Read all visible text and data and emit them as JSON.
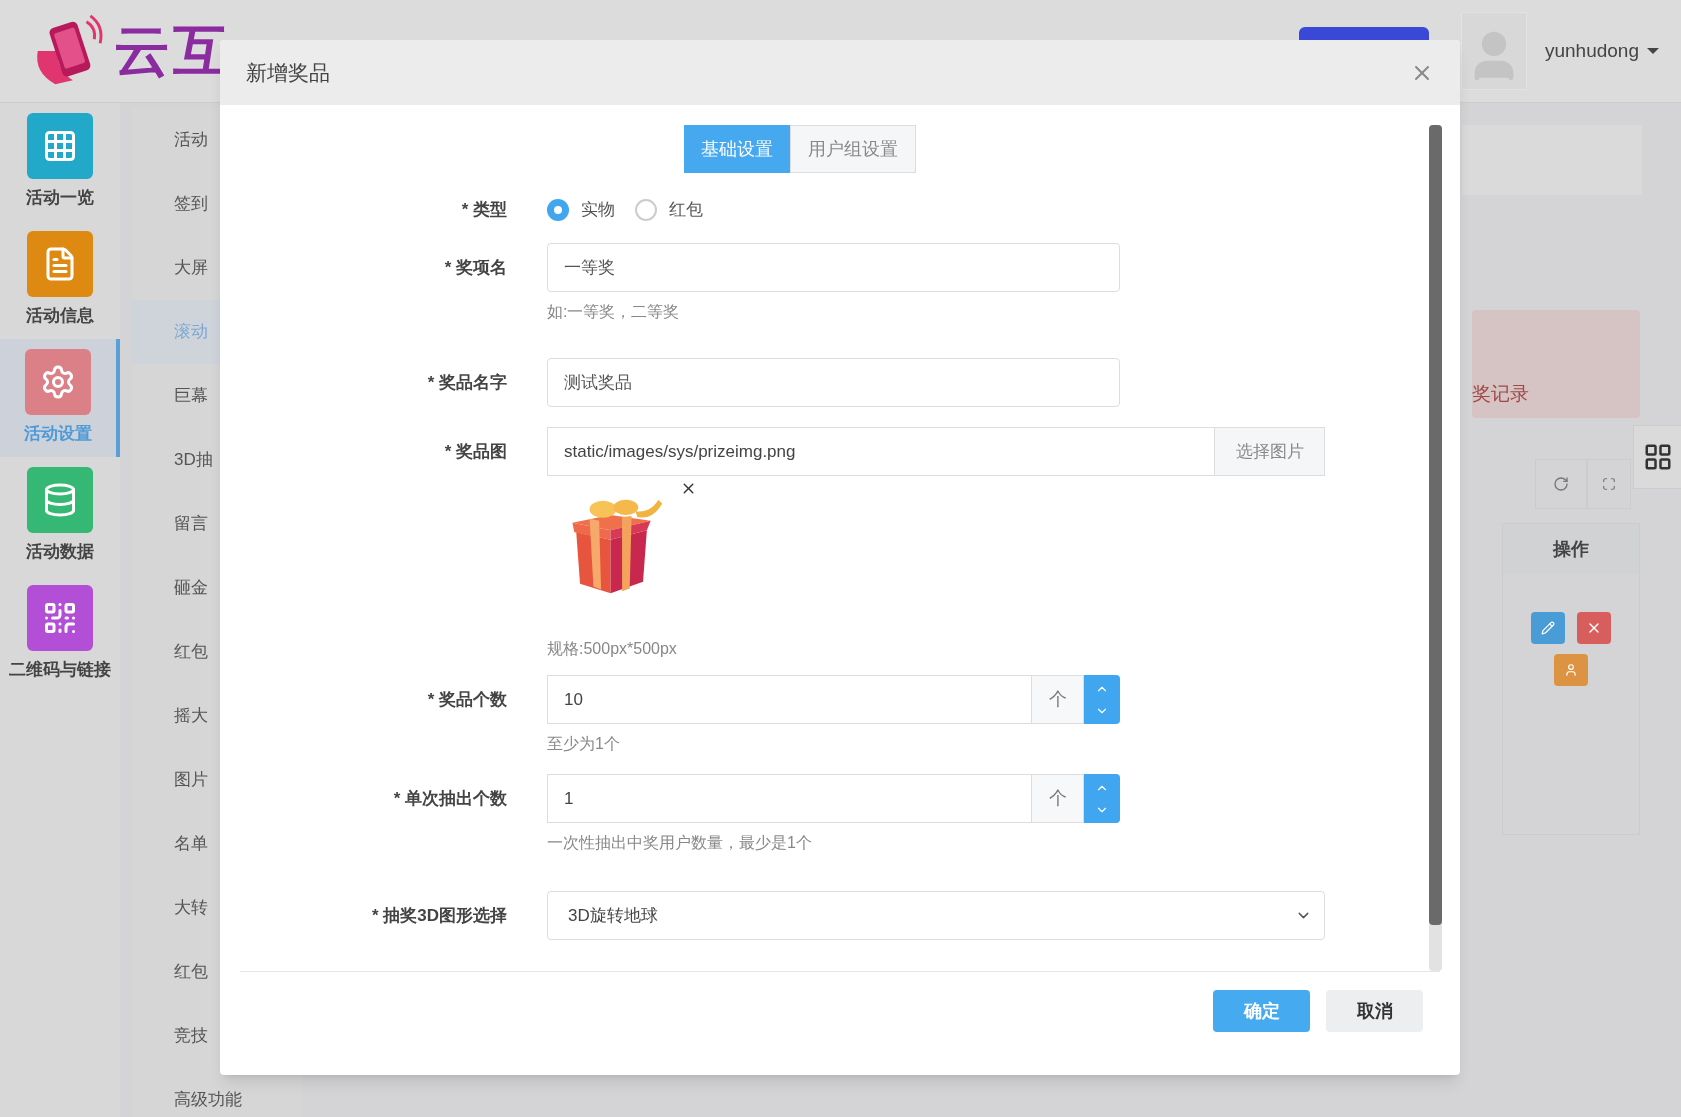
{
  "header": {
    "logo_text": "云互",
    "username": "yunhudong"
  },
  "icon_sidebar": [
    {
      "label": "活动一览",
      "color": "#22a8c8",
      "selected": false
    },
    {
      "label": "活动信息",
      "color": "#de8a12",
      "selected": false
    },
    {
      "label": "活动设置",
      "color": "#dc8088",
      "selected": true
    },
    {
      "label": "活动数据",
      "color": "#34b873",
      "selected": false
    },
    {
      "label": "二维码与链接",
      "color": "#b24fd6",
      "selected": false
    }
  ],
  "sub_sidebar": [
    {
      "label": "活动",
      "selected": false
    },
    {
      "label": "签到",
      "selected": false
    },
    {
      "label": "大屏",
      "selected": false
    },
    {
      "label": "滚动",
      "selected": true
    },
    {
      "label": "巨幕",
      "selected": false
    },
    {
      "label": "3D抽",
      "selected": false
    },
    {
      "label": "留言",
      "selected": false
    },
    {
      "label": "砸金",
      "selected": false
    },
    {
      "label": "红包",
      "selected": false
    },
    {
      "label": "摇大",
      "selected": false
    },
    {
      "label": "图片",
      "selected": false
    },
    {
      "label": "名单",
      "selected": false
    },
    {
      "label": "大转",
      "selected": false
    },
    {
      "label": "红包",
      "selected": false
    },
    {
      "label": "竞技",
      "selected": false
    },
    {
      "label": "高级功能",
      "selected": false
    }
  ],
  "background_card": {
    "text": "奖记录"
  },
  "table": {
    "columns": [
      "操作"
    ]
  },
  "modal": {
    "title": "新增奖品",
    "tabs": [
      {
        "label": "基础设置",
        "selected": true
      },
      {
        "label": "用户组设置",
        "selected": false
      }
    ],
    "fields": [
      {
        "kind": "radio",
        "label": "* 类型",
        "options": [
          {
            "label": "实物",
            "selected": true
          },
          {
            "label": "红包",
            "selected": false
          }
        ]
      },
      {
        "kind": "text",
        "label": "* 奖项名",
        "value": "一等奖",
        "hint": "如:一等奖，二等奖"
      },
      {
        "kind": "text",
        "label": "* 奖品名字",
        "value": "测试奖品"
      },
      {
        "kind": "file",
        "label": "* 奖品图",
        "value": "static/images/sys/prizeimg.png",
        "button": "选择图片",
        "hint": "规格:500px*500px"
      },
      {
        "kind": "number",
        "label": "* 奖品个数",
        "value": "10",
        "unit": "个",
        "hint": "至少为1个"
      },
      {
        "kind": "number",
        "label": "* 单次抽出个数",
        "value": "1",
        "unit": "个",
        "hint": "一次性抽出中奖用户数量，最少是1个"
      },
      {
        "kind": "select",
        "label": "* 抽奖3D图形选择",
        "value": "3D旋转地球"
      }
    ],
    "buttons": [
      {
        "label": "确定",
        "kind": "primary"
      },
      {
        "label": "取消",
        "kind": "default"
      }
    ]
  }
}
